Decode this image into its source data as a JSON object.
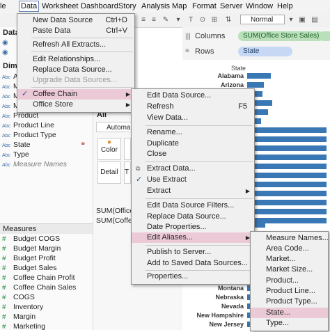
{
  "menubar": [
    "le",
    "Data",
    "Worksheet",
    "Dashboard",
    "Story",
    "Analysis",
    "Map",
    "Format",
    "Server",
    "Window",
    "Help"
  ],
  "toolbar": {
    "fit": "Normal"
  },
  "datapane": {
    "title": "Data",
    "dimensions_title": "Dime",
    "dimensions": [
      {
        "icon": "Abc",
        "label": "A"
      },
      {
        "icon": "Abc",
        "label": "M"
      },
      {
        "icon": "Abc",
        "label": "M"
      },
      {
        "icon": "Abc",
        "label": "M"
      },
      {
        "icon": "Abc",
        "label": "Product"
      },
      {
        "icon": "Abc",
        "label": "Product Line"
      },
      {
        "icon": "Abc",
        "label": "Product Type"
      },
      {
        "icon": "Abc",
        "label": "State"
      },
      {
        "icon": "Abc",
        "label": "Type"
      },
      {
        "icon": "Abc",
        "label": "Measure Names"
      }
    ],
    "measures_title": "Measures",
    "measures": [
      "Budget COGS",
      "Budget Margin",
      "Budget Profit",
      "Budget Sales",
      "Coffee Chain Profit",
      "Coffee Chain Sales",
      "COGS",
      "Inventory",
      "Margin",
      "Marketing"
    ]
  },
  "markscard": {
    "all": "All",
    "type": "Automa",
    "color": "Color",
    "detail": "Detail",
    "t": "T",
    "sum1": "SUM(Office",
    "sum2": "SUM(Coffee"
  },
  "shelves": {
    "columns_label": "Columns",
    "rows_label": "Rows",
    "columns_pill": "SUM(Office Store Sales)",
    "rows_pill": "State"
  },
  "chart": {
    "header": "State",
    "top_states": [
      "Alabama",
      "Arizona"
    ],
    "bottom_states": [
      "Montana",
      "Nebraska",
      "Nevada",
      "New Hampshire",
      "New Jersey"
    ]
  },
  "data_menu": [
    {
      "label": "New Data Source",
      "shortcut": "Ctrl+D"
    },
    {
      "label": "Paste Data",
      "shortcut": "Ctrl+V"
    },
    {
      "sep": true
    },
    {
      "label": "Refresh All Extracts..."
    },
    {
      "sep": true
    },
    {
      "label": "Edit Relationships..."
    },
    {
      "label": "Replace Data Source..."
    },
    {
      "label": "Upgrade Data Sources...",
      "disabled": true
    },
    {
      "sep": true
    },
    {
      "label": "Coffee Chain",
      "check": true,
      "arrow": true,
      "hl": true
    },
    {
      "label": "Office Store",
      "arrow": true
    }
  ],
  "source_menu": [
    {
      "label": "Edit Data Source..."
    },
    {
      "label": "Refresh",
      "shortcut": "F5"
    },
    {
      "label": "View Data..."
    },
    {
      "sep": true
    },
    {
      "label": "Rename..."
    },
    {
      "label": "Duplicate"
    },
    {
      "label": "Close"
    },
    {
      "sep": true
    },
    {
      "label": "Extract Data..."
    },
    {
      "label": "Use Extract",
      "check": true
    },
    {
      "label": "Extract",
      "arrow": true
    },
    {
      "sep": true
    },
    {
      "label": "Edit Data Source Filters..."
    },
    {
      "label": "Replace Data Source..."
    },
    {
      "label": "Date Properties..."
    },
    {
      "label": "Edit Aliases...",
      "arrow": true,
      "hl": true
    },
    {
      "sep": true
    },
    {
      "label": "Publish to Server..."
    },
    {
      "label": "Add to Saved Data Sources..."
    },
    {
      "sep": true
    },
    {
      "label": "Properties..."
    }
  ],
  "alias_menu": [
    {
      "label": "Measure Names..."
    },
    {
      "label": "Area Code..."
    },
    {
      "label": "Market..."
    },
    {
      "label": "Market Size..."
    },
    {
      "label": "Product..."
    },
    {
      "label": "Product Line..."
    },
    {
      "label": "Product Type..."
    },
    {
      "label": "State...",
      "hl": true
    },
    {
      "label": "Type..."
    }
  ]
}
